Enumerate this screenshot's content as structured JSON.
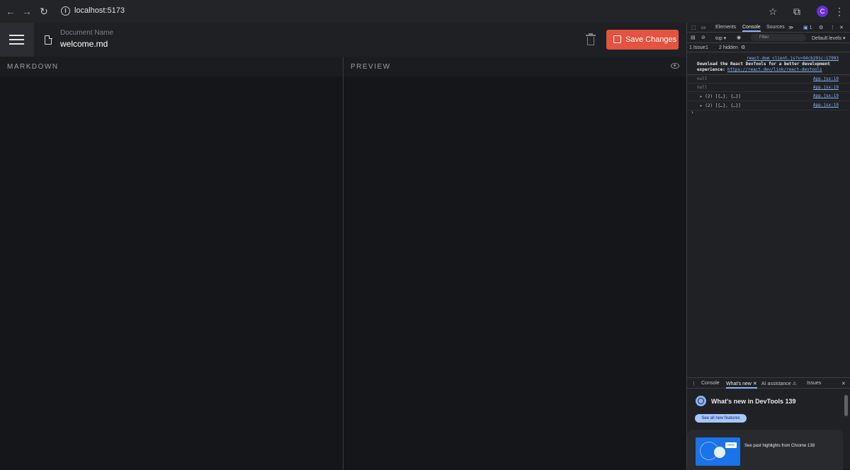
{
  "browser": {
    "url": "localhost:5173",
    "avatar_letter": "C"
  },
  "app": {
    "document_label": "Document Name",
    "document_name": "welcome.md",
    "save_label": "Save Changes",
    "markdown_title": "MARKDOWN",
    "preview_title": "PREVIEW",
    "accent_color": "#e4533f"
  },
  "devtools": {
    "tabs": [
      "Elements",
      "Console",
      "Sources"
    ],
    "more_tabs": "≫",
    "issue_count": "1",
    "context": "top ▾",
    "filter_placeholder": "Filter",
    "levels": "Default levels ▾",
    "issues_label": "1 Issue:",
    "issues_count": "1",
    "hidden_label": "2 hidden",
    "console_rows": [
      {
        "text": "react-dom_client.js?v=94cb291c:17993",
        "kind": "link"
      },
      {
        "text": "Download the React DevTools for a better development",
        "kind": "bold"
      },
      {
        "text": "experience:",
        "kind": "bold",
        "link": "https://react.dev/link/react-devtools"
      },
      {
        "text": "null",
        "kind": "grey",
        "src": "App.jsx:19"
      },
      {
        "text": "null",
        "kind": "grey",
        "src": "App.jsx:19"
      },
      {
        "text": "▸ (2) [{…}, {…}]",
        "kind": "plain",
        "src": "App.jsx:19"
      },
      {
        "text": "▸ (2) [{…}, {…}]",
        "kind": "plain",
        "src": "App.jsx:19"
      }
    ],
    "prompt": "›",
    "drawer_tabs": [
      "Console",
      "What's new",
      "AI assistance",
      "Issues"
    ],
    "whats_new_title": "What's new in DevTools 139",
    "see_all_label": "See all new features",
    "card_badge": "new",
    "card_text": "See past highlights from Chrome 138"
  }
}
